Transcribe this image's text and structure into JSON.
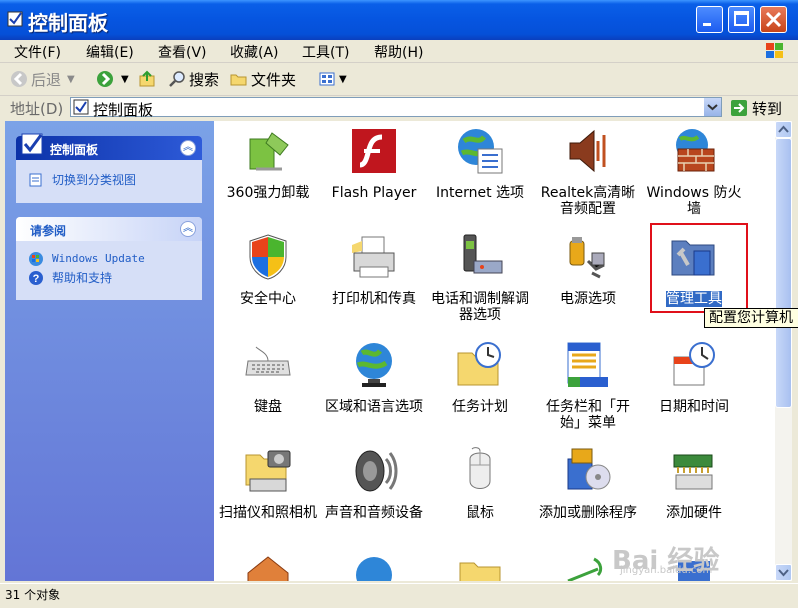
{
  "window": {
    "title": "控制面板"
  },
  "menu": [
    "文件(F)",
    "编辑(E)",
    "查看(V)",
    "收藏(A)",
    "工具(T)",
    "帮助(H)"
  ],
  "toolbar": {
    "back": "后退",
    "search": "搜索",
    "folders": "文件夹"
  },
  "address": {
    "label": "地址(D)",
    "value": "控制面板",
    "go": "转到"
  },
  "sidebar": {
    "panel1": {
      "title": "控制面板",
      "link": "切换到分类视图"
    },
    "panel2": {
      "title": "请参阅",
      "links": [
        "Windows Update",
        "帮助和支持"
      ]
    }
  },
  "items": [
    {
      "label": "360强力卸载",
      "icon": "uninstall-icon"
    },
    {
      "label": "Flash Player",
      "icon": "flash-icon"
    },
    {
      "label": "Internet 选项",
      "icon": "internet-options-icon"
    },
    {
      "label": "Realtek高清晰音频配置",
      "icon": "speaker-icon"
    },
    {
      "label": "Windows 防火墙",
      "icon": "firewall-icon"
    },
    {
      "label": "安全中心",
      "icon": "shield-icon"
    },
    {
      "label": "打印机和传真",
      "icon": "printer-icon"
    },
    {
      "label": "电话和调制解调器选项",
      "icon": "phone-icon"
    },
    {
      "label": "电源选项",
      "icon": "power-icon"
    },
    {
      "label": "管理工具",
      "icon": "admin-tools-icon",
      "selected": true
    },
    {
      "label": "键盘",
      "icon": "keyboard-icon"
    },
    {
      "label": "区域和语言选项",
      "icon": "globe-icon"
    },
    {
      "label": "任务计划",
      "icon": "task-icon"
    },
    {
      "label": "任务栏和「开始」菜单",
      "icon": "taskbar-icon"
    },
    {
      "label": "日期和时间",
      "icon": "clock-icon"
    },
    {
      "label": "扫描仪和照相机",
      "icon": "scanner-icon"
    },
    {
      "label": "声音和音频设备",
      "icon": "audio-icon"
    },
    {
      "label": "鼠标",
      "icon": "mouse-icon"
    },
    {
      "label": "添加或删除程序",
      "icon": "add-remove-icon"
    },
    {
      "label": "添加硬件",
      "icon": "hardware-icon"
    }
  ],
  "tooltip": "配置您计算机",
  "status": "31 个对象",
  "watermark": "Bai 经验",
  "watermark_sub": "jingyan.baidu.com",
  "colors": {
    "title_blue": "#0655E0",
    "selection": "#316AC5",
    "highlight": "#E0101A"
  }
}
